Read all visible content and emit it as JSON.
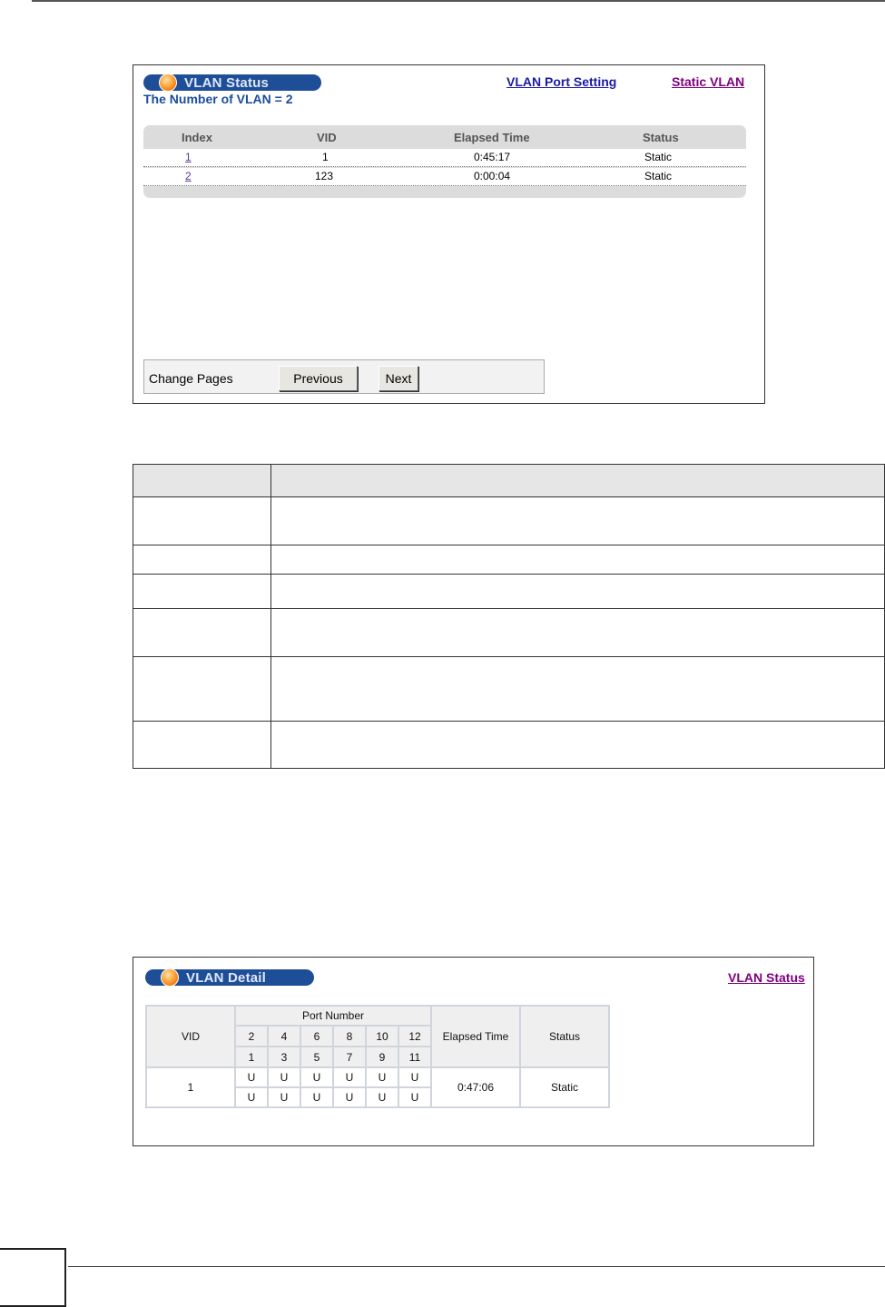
{
  "status_panel": {
    "title": "VLAN Status",
    "vlan_count_label": "The Number of VLAN = 2",
    "links": {
      "port_setting": "VLAN Port Setting",
      "static_vlan": "Static VLAN"
    },
    "table": {
      "headers": [
        "Index",
        "VID",
        "Elapsed Time",
        "Status"
      ],
      "rows": [
        [
          "1",
          "1",
          "0:45:17",
          "Static"
        ],
        [
          "2",
          "123",
          "0:00:04",
          "Static"
        ]
      ]
    },
    "change_pages": {
      "label": "Change Pages",
      "previous": "Previous",
      "next": "Next"
    }
  },
  "detail_panel": {
    "title": "VLAN Detail",
    "link": "VLAN Status",
    "table": {
      "vid_header": "VID",
      "port_header": "Port Number",
      "elapsed_header": "Elapsed Time",
      "status_header": "Status",
      "ports_top": [
        "2",
        "4",
        "6",
        "8",
        "10",
        "12"
      ],
      "ports_bottom": [
        "1",
        "3",
        "5",
        "7",
        "9",
        "11"
      ],
      "vid": "1",
      "row_top": [
        "U",
        "U",
        "U",
        "U",
        "U",
        "U"
      ],
      "row_bottom": [
        "U",
        "U",
        "U",
        "U",
        "U",
        "U"
      ],
      "elapsed": "0:47:06",
      "status": "Static"
    }
  },
  "colors": {
    "pill": "#1f4e98",
    "link_blue": "#1a1aa6",
    "link_purple": "#800080"
  }
}
